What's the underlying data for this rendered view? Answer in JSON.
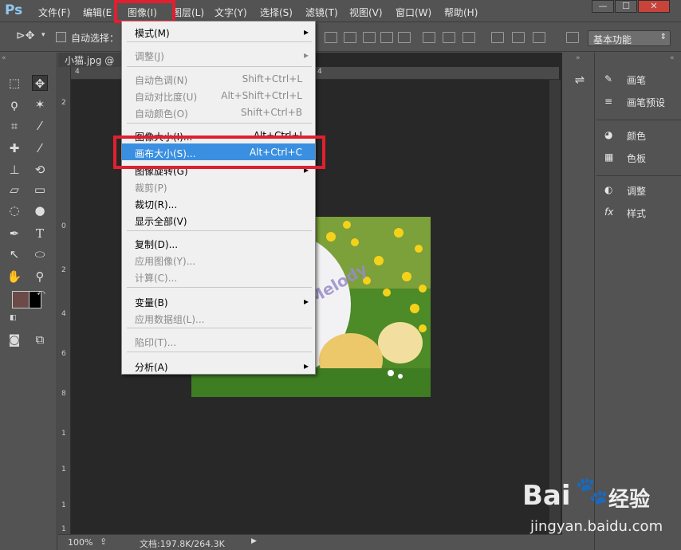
{
  "app": {
    "logo": "Ps"
  },
  "menubar": {
    "items": [
      "文件(F)",
      "编辑(E",
      "图像(I)",
      "图层(L)",
      "文字(Y)",
      "选择(S)",
      "滤镜(T)",
      "视图(V)",
      "窗口(W)",
      "帮助(H)"
    ],
    "window_buttons": [
      "—",
      "☐",
      "✕"
    ]
  },
  "options_bar": {
    "auto_select_label": "自动选择：",
    "workspace": "基本功能"
  },
  "document": {
    "tab_title": "小猫.jpg @",
    "zoom": "100%",
    "doc_info": "文档:197.8K/264.3K",
    "watermark": "MyMelody"
  },
  "ruler": {
    "top": [
      "4",
      "4"
    ],
    "left": [
      "2",
      "0",
      "2",
      "4",
      "6",
      "8",
      "1",
      "1",
      "1",
      "1"
    ]
  },
  "menu": {
    "items": [
      {
        "label": "模式(M)",
        "shortcut": "",
        "submenu": true,
        "disabled": false
      },
      {
        "label": "调整(J)",
        "shortcut": "",
        "submenu": true,
        "disabled": true
      },
      {
        "label": "自动色调(N)",
        "shortcut": "Shift+Ctrl+L",
        "submenu": false,
        "disabled": true
      },
      {
        "label": "自动对比度(U)",
        "shortcut": "Alt+Shift+Ctrl+L",
        "submenu": false,
        "disabled": true
      },
      {
        "label": "自动颜色(O)",
        "shortcut": "Shift+Ctrl+B",
        "submenu": false,
        "disabled": true
      },
      {
        "label": "图像大小(I)...",
        "shortcut": "Alt+Ctrl+I",
        "submenu": false,
        "disabled": false
      },
      {
        "label": "画布大小(S)...",
        "shortcut": "Alt+Ctrl+C",
        "submenu": false,
        "disabled": false,
        "highlighted": true
      },
      {
        "label": "图像旋转(G)",
        "shortcut": "",
        "submenu": true,
        "disabled": false
      },
      {
        "label": "裁剪(P)",
        "shortcut": "",
        "submenu": false,
        "disabled": true
      },
      {
        "label": "裁切(R)...",
        "shortcut": "",
        "submenu": false,
        "disabled": false
      },
      {
        "label": "显示全部(V)",
        "shortcut": "",
        "submenu": false,
        "disabled": false
      },
      {
        "label": "复制(D)...",
        "shortcut": "",
        "submenu": false,
        "disabled": false
      },
      {
        "label": "应用图像(Y)...",
        "shortcut": "",
        "submenu": false,
        "disabled": true
      },
      {
        "label": "计算(C)...",
        "shortcut": "",
        "submenu": false,
        "disabled": true
      },
      {
        "label": "变量(B)",
        "shortcut": "",
        "submenu": true,
        "disabled": false
      },
      {
        "label": "应用数据组(L)...",
        "shortcut": "",
        "submenu": false,
        "disabled": true
      },
      {
        "label": "陷印(T)...",
        "shortcut": "",
        "submenu": false,
        "disabled": true
      },
      {
        "label": "分析(A)",
        "shortcut": "",
        "submenu": true,
        "disabled": false
      }
    ]
  },
  "panels": {
    "items": [
      "画笔",
      "画笔预设",
      "颜色",
      "色板",
      "调整",
      "样式"
    ]
  },
  "watermark": {
    "brand": "Bai",
    "brand_cn": "经验",
    "url": "jingyan.baidu.com"
  },
  "colors": {
    "highlight": "#3a8fe0",
    "annotation": "#e02030",
    "foreground": "#6b4a48",
    "background": "#000000"
  }
}
